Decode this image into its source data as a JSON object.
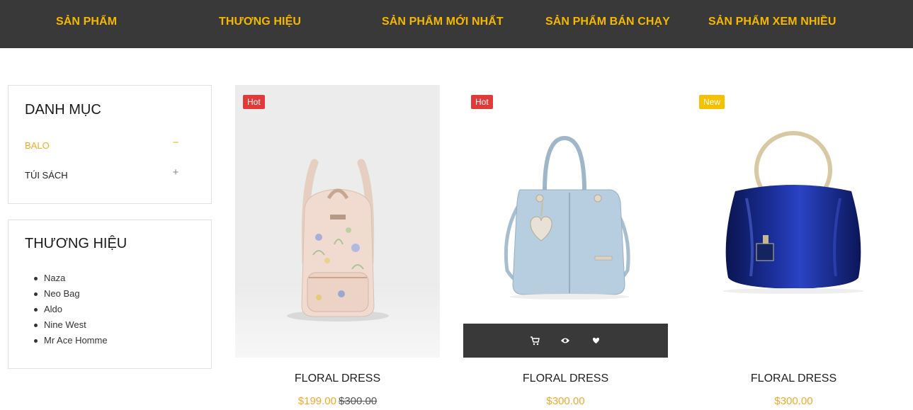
{
  "nav": {
    "items": [
      "SẢN PHẨM",
      "THƯƠNG HIỆU",
      "SẢN PHẨM MỚI NHẤT",
      "SẢN PHẨM BÁN CHẠY",
      "SẢN PHẨM XEM NHIỀU"
    ]
  },
  "sidebar": {
    "categories": {
      "title": "DANH MỤC",
      "items": [
        {
          "label": "BALO",
          "toggle": "−",
          "active": true
        },
        {
          "label": "TÚI SÁCH",
          "toggle": "+",
          "active": false
        }
      ]
    },
    "brands": {
      "title": "THƯƠNG HIỆU",
      "items": [
        "Naza",
        "Neo Bag",
        "Aldo",
        "Nine West",
        "Mr Ace Homme"
      ]
    }
  },
  "products": [
    {
      "badge": "Hot",
      "name": "FLORAL DRESS",
      "price": "$199.00",
      "old_price": "$300.00"
    },
    {
      "badge": "Hot",
      "name": "FLORAL DRESS",
      "price": "$300.00",
      "old_price": ""
    },
    {
      "badge": "New",
      "name": "FLORAL DRESS",
      "price": "$300.00",
      "old_price": ""
    }
  ],
  "colors": {
    "nav_bg": "#393939",
    "accent": "#f5b800",
    "hot": "#e03a3a",
    "new": "#f5c000"
  },
  "icons": {
    "actions": [
      "cart-icon",
      "eye-icon",
      "heart-icon"
    ]
  }
}
